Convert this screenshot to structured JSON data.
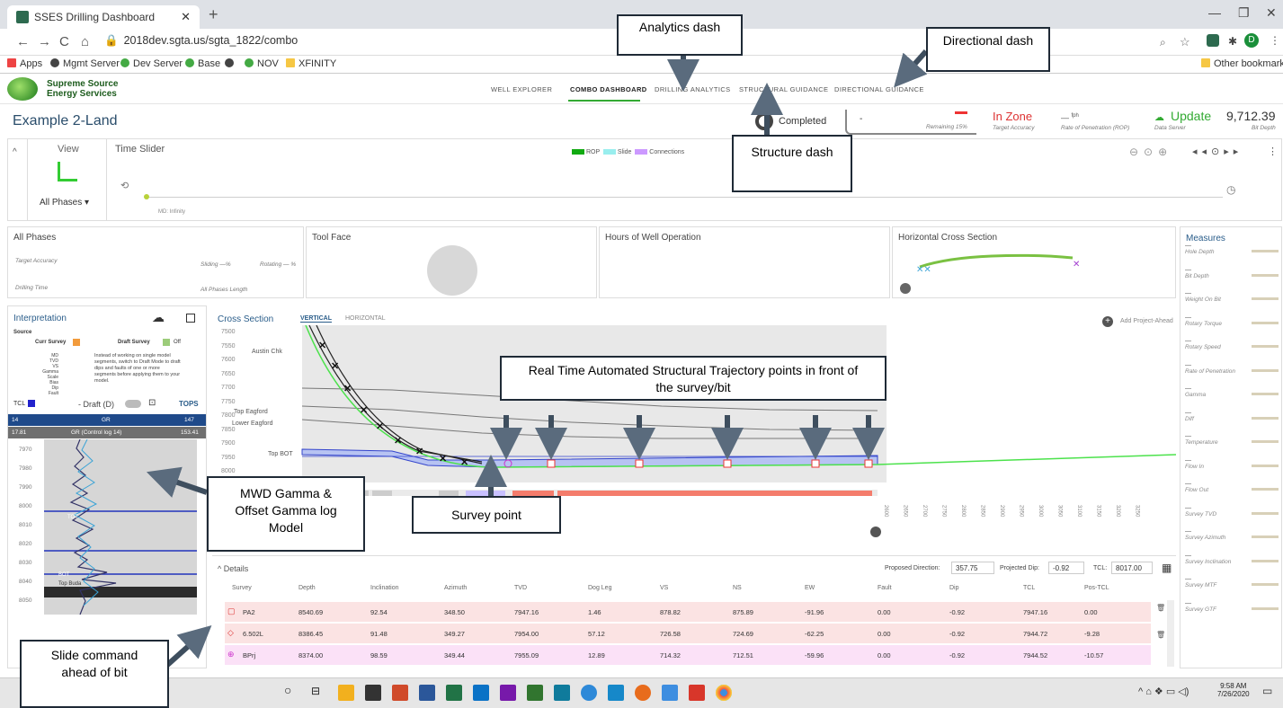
{
  "browser": {
    "tab_title": "SSES Drilling Dashboard",
    "url": "2018dev.sgta.us/sgta_1822/combo",
    "bookmarks": [
      "Apps",
      "Mgmt Server",
      "Dev Server",
      "Base",
      "NOV",
      "XFINITY"
    ],
    "other_bookmarks": "Other bookmarks",
    "profile_initial": "D"
  },
  "app": {
    "brand_line1": "Supreme Source",
    "brand_line2": "Energy Services",
    "nav": [
      "WELL EXPLORER",
      "COMBO DASHBOARD",
      "DRILLING ANALYTICS",
      "STRUCTURAL GUIDANCE",
      "DIRECTIONAL GUIDANCE"
    ],
    "well_name": "Example 2-Land",
    "status": "Completed",
    "remaining_dash": "-",
    "remaining_label": "Remaining 15%",
    "in_zone": "In Zone",
    "target_accuracy": "Target Accuracy",
    "rop_unit": "fph",
    "rop_label": "Rate of Penetration (ROP)",
    "update": "Update",
    "data_server": "Data Server",
    "bit_depth": "9,712.39",
    "bit_depth_label": "Bit Depth"
  },
  "time_slider": {
    "view_label": "View",
    "phase": "All Phases",
    "title": "Time Slider",
    "legend": [
      "ROP",
      "Slide",
      "Connections"
    ],
    "md_label": "MD: Infinity"
  },
  "cards": {
    "all_phases": "All Phases",
    "target_accuracy": "Target Accuracy",
    "drilling_time": "Drilling Time",
    "sliding": "Sliding —%",
    "rotating": "Rotating — %",
    "all_phases_length": "All Phases Length",
    "tool_face": "Tool Face",
    "hours": "Hours of Well Operation",
    "horiz": "Horizontal Cross Section",
    "measures": "Measures",
    "measure_items": [
      "Hole Depth",
      "Bit Depth",
      "Weight On Bit",
      "Rotary Torque",
      "Rotary Speed",
      "Rate of Penetration",
      "Gamma",
      "Diff",
      "Temperature",
      "Flow In",
      "Flow Out",
      "Survey TVD",
      "Survey Azimuth",
      "Survey Inclination",
      "Survey MTF",
      "Survey GTF"
    ]
  },
  "interpretation": {
    "title": "Interpretation",
    "source": "Source",
    "curr_survey": "Curr Survey",
    "draft_survey": "Draft Survey",
    "off": "Off",
    "note": "Instead of working on single model segments, switch to Draft Mode to draft dips and faults of one or more segments before applying them to your model.",
    "tcl": "TCL",
    "draft": "Draft (D)",
    "tops": "TOPS",
    "gr_row1": [
      "14",
      "GR",
      "147"
    ],
    "gr_row2": [
      "17.81",
      "GR (Control log 14)",
      "153.41"
    ],
    "depths": [
      "7970",
      "7980",
      "7990",
      "8000",
      "8010",
      "8020",
      "8030",
      "8040",
      "8050"
    ],
    "tot": "TOT",
    "bot": "BOT",
    "top_buda": "Top Buda"
  },
  "cross_section": {
    "title": "Cross Section",
    "tab_vertical": "VERTICAL",
    "tab_horizontal": "HORIZONTAL",
    "add_project": "Add Project-Ahead",
    "y_ticks": [
      "7500",
      "7550",
      "7600",
      "7650",
      "7700",
      "7750",
      "7800",
      "7850",
      "7900",
      "7950",
      "8000"
    ],
    "formations": [
      "Austin Chk",
      "Top Eagford",
      "Lower Eagford",
      "Top BOT"
    ]
  },
  "details": {
    "toggle": "Details",
    "proposed_direction_label": "Proposed Direction:",
    "proposed_direction": "357.75",
    "projected_dip_label": "Projected Dip:",
    "projected_dip": "-0.92",
    "tcl_label": "TCL:",
    "tcl": "8017.00",
    "headers": [
      "Survey",
      "Depth",
      "Inclination",
      "Azimuth",
      "TVD",
      "Dog Leg",
      "VS",
      "NS",
      "EW",
      "Fault",
      "Dip",
      "TCL",
      "Pos-TCL"
    ],
    "rows": [
      [
        "PA2",
        "8540.69",
        "92.54",
        "348.50",
        "7947.16",
        "1.46",
        "878.82",
        "875.89",
        "-91.96",
        "0.00",
        "-0.92",
        "7947.16",
        "0.00"
      ],
      [
        "6.502L",
        "8386.45",
        "91.48",
        "349.27",
        "7954.00",
        "57.12",
        "726.58",
        "724.69",
        "-62.25",
        "0.00",
        "-0.92",
        "7944.72",
        "-9.28"
      ],
      [
        "BPrj",
        "8374.00",
        "98.59",
        "349.44",
        "7955.09",
        "12.89",
        "714.32",
        "712.51",
        "-59.96",
        "0.00",
        "-0.92",
        "7944.52",
        "-10.57"
      ]
    ]
  },
  "taskbar": {
    "time": "9:58 AM",
    "date": "7/26/2020"
  },
  "annotations": {
    "analytics": "Analytics dash",
    "directional": "Directional dash",
    "structure": "Structure dash",
    "realtime": "Real Time Automated  Structural Trajectory points in front of the survey/bit",
    "mwd": "MWD Gamma & Offset Gamma log Model",
    "survey": "Survey point",
    "slide": "Slide command ahead of bit"
  }
}
